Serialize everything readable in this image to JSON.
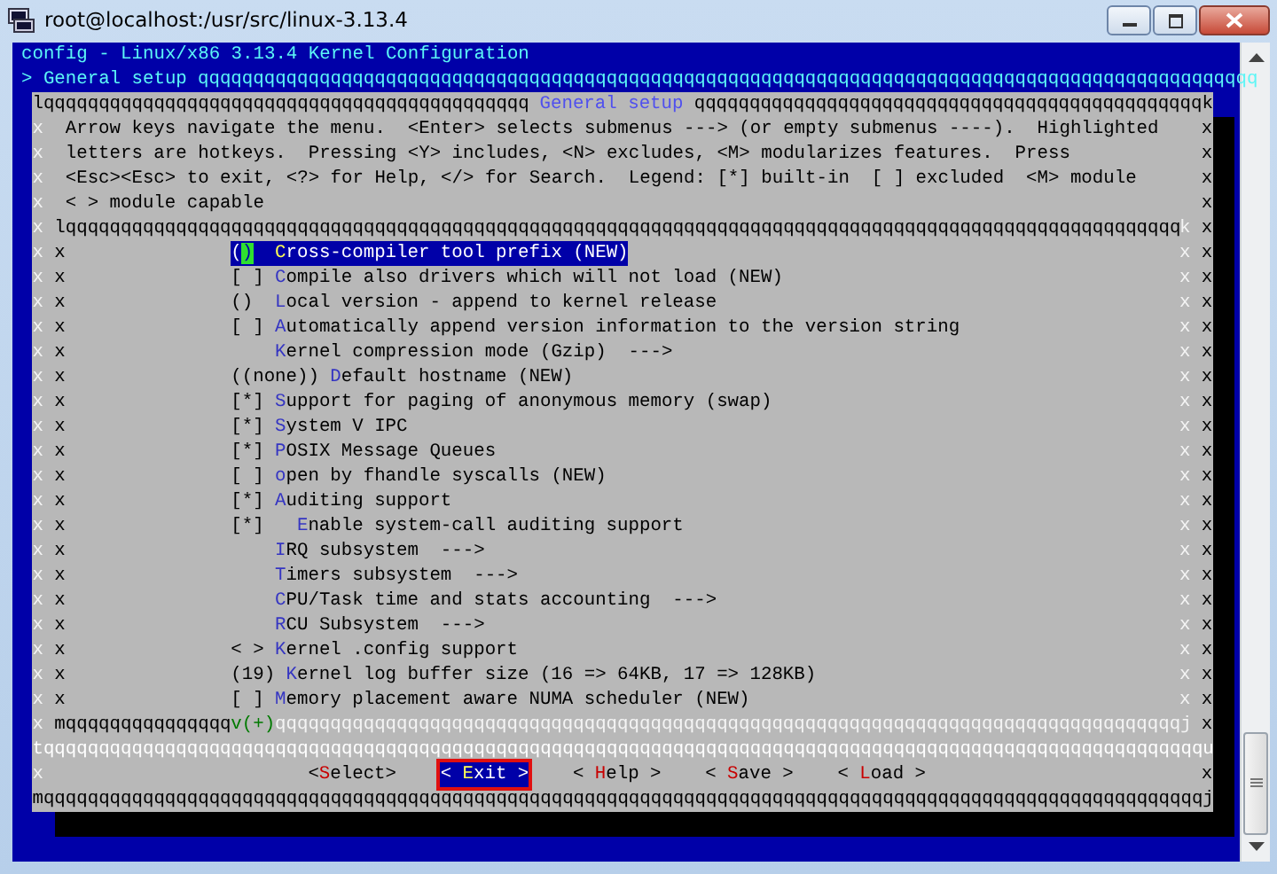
{
  "window": {
    "title": "root@localhost:/usr/src/linux-3.13.4"
  },
  "header": {
    "title": "config - Linux/x86 3.13.4 Kernel Configuration",
    "breadcrumb": "> General setup",
    "rule": "qqqqqqqqqqqqqqqqqqqqqqqqqqqqqqqqqqqqqqqqqqqqqqqqqqqqqqqqqqqqqqqqqqqqqqqqqqqqqqqqqqqqqqqqqqqqqqqq"
  },
  "dialog": {
    "top_left": "lqqqqqqqqqqqqqqqqqqqqqqqqqqqqqqqqqqqqqqqqqqqq",
    "title": "General setup",
    "top_right": "qqqqqqqqqqqqqqqqqqqqqqqqqqqqqqqqqqqqqqqqqqqqqqk",
    "help": [
      {
        "frame": [
          "x",
          "x"
        ],
        "text": "Arrow keys navigate the menu.  <Enter> selects submenus ---> (or empty submenus ----).  Highlighted"
      },
      {
        "frame": [
          "x",
          "x"
        ],
        "text": "letters are hotkeys.  Pressing <Y> includes, <N> excludes, <M> modularizes features.  Press"
      },
      {
        "frame": [
          "x",
          "x"
        ],
        "text": "<Esc><Esc> to exit, <?> for Help, </> for Search.  Legend: [*] built-in  [ ] excluded  <M> module"
      },
      {
        "frame": [
          "x",
          "x"
        ],
        "text": "< > module capable"
      }
    ],
    "menu": {
      "top": {
        "frame": [
          "x",
          "x"
        ],
        "rule": "lqqqqqqqqqqqqqqqqqqqqqqqqqqqqqqqqqqqqqqqqqqqqqqqqqqqqqqqqqqqqqqqqqqqqqqqqqqqqqqqqqqqqqqqqqqqqqqqqqqqqq",
        "corner": "k"
      },
      "items": [
        {
          "frame": [
            "x",
            "x",
            "x",
            "x"
          ],
          "prefix": "()",
          "label": "Cross-compiler tool prefix (NEW)",
          "selected": true
        },
        {
          "frame": [
            "x",
            "x",
            "x",
            "x"
          ],
          "prefix": "[ ]",
          "label": "Compile also drivers which will not load (NEW)",
          "selected": false
        },
        {
          "frame": [
            "x",
            "x",
            "x",
            "x"
          ],
          "prefix": "()",
          "label": "Local version - append to kernel release",
          "selected": false
        },
        {
          "frame": [
            "x",
            "x",
            "x",
            "x"
          ],
          "prefix": "[ ]",
          "label": "Automatically append version information to the version string",
          "selected": false
        },
        {
          "frame": [
            "x",
            "x",
            "x",
            "x"
          ],
          "label": "Kernel compression mode (Gzip)  --->",
          "selected": false
        },
        {
          "frame": [
            "x",
            "x",
            "x",
            "x"
          ],
          "prefix": "((none))",
          "label": "Default hostname (NEW)",
          "selected": false
        },
        {
          "frame": [
            "x",
            "x",
            "x",
            "x"
          ],
          "prefix": "[*]",
          "label": "Support for paging of anonymous memory (swap)",
          "selected": false
        },
        {
          "frame": [
            "x",
            "x",
            "x",
            "x"
          ],
          "prefix": "[*]",
          "label": "System V IPC",
          "selected": false
        },
        {
          "frame": [
            "x",
            "x",
            "x",
            "x"
          ],
          "prefix": "[*]",
          "label": "POSIX Message Queues",
          "selected": false
        },
        {
          "frame": [
            "x",
            "x",
            "x",
            "x"
          ],
          "prefix": "[ ]",
          "label": "open by fhandle syscalls (NEW)",
          "selected": false
        },
        {
          "frame": [
            "x",
            "x",
            "x",
            "x"
          ],
          "prefix": "[*]",
          "label": "Auditing support",
          "selected": false,
          "children": [
            {
              "frame": [
                "x",
                "x",
                "x",
                "x"
              ],
              "prefix": "[*]",
              "label": "Enable system-call auditing support",
              "selected": false
            }
          ]
        },
        {
          "frame": [
            "x",
            "x",
            "x",
            "x"
          ],
          "label": "IRQ subsystem  --->",
          "selected": false
        },
        {
          "frame": [
            "x",
            "x",
            "x",
            "x"
          ],
          "label": "Timers subsystem  --->",
          "selected": false
        },
        {
          "frame": [
            "x",
            "x",
            "x",
            "x"
          ],
          "label": "CPU/Task time and stats accounting  --->",
          "selected": false
        },
        {
          "frame": [
            "x",
            "x",
            "x",
            "x"
          ],
          "label": "RCU Subsystem  --->",
          "selected": false
        },
        {
          "frame": [
            "x",
            "x",
            "x",
            "x"
          ],
          "prefix": "< >",
          "label": "Kernel .config support",
          "selected": false
        },
        {
          "frame": [
            "x",
            "x",
            "x",
            "x"
          ],
          "prefix": "(19)",
          "label": "Kernel log buffer size (16 => 64KB, 17 => 128KB)",
          "selected": false
        },
        {
          "frame": [
            "x",
            "x",
            "x",
            "x"
          ],
          "prefix": "[ ]",
          "label": "Memory placement aware NUMA scheduler (NEW)",
          "selected": false
        }
      ],
      "bottom": {
        "frame": [
          "x",
          "x"
        ],
        "rule_left": "mqqqqqqqqqqqqqqq",
        "more": "v(+)",
        "rule_right": "qqqqqqqqqqqqqqqqqqqqqqqqqqqqqqqqqqqqqqqqqqqqqqqqqqqqqqqqqqqqqqqqqqqqqqqqqqqqqqqqqqj"
      }
    },
    "separator": "tqqqqqqqqqqqqqqqqqqqqqqqqqqqqqqqqqqqqqqqqqqqqqqqqqqqqqqqqqqqqqqqqqqqqqqqqqqqqqqqqqqqqqqqqqqqqqqqqqqqqqqqqqu",
    "button_frame": [
      "x",
      "x"
    ],
    "buttons": [
      {
        "label": "<Select>",
        "selected": false
      },
      {
        "label": "< Exit >",
        "selected": true
      },
      {
        "label": "< Help >",
        "selected": false
      },
      {
        "label": "< Save >",
        "selected": false
      },
      {
        "label": "< Load >",
        "selected": false
      }
    ],
    "bottom": "mqqqqqqqqqqqqqqqqqqqqqqqqqqqqqqqqqqqqqqqqqqqqqqqqqqqqqqqqqqqqqqqqqqqqqqqqqqqqqqqqqqqqqqqqqqqqqqqqqqqqqqqqqj"
  }
}
